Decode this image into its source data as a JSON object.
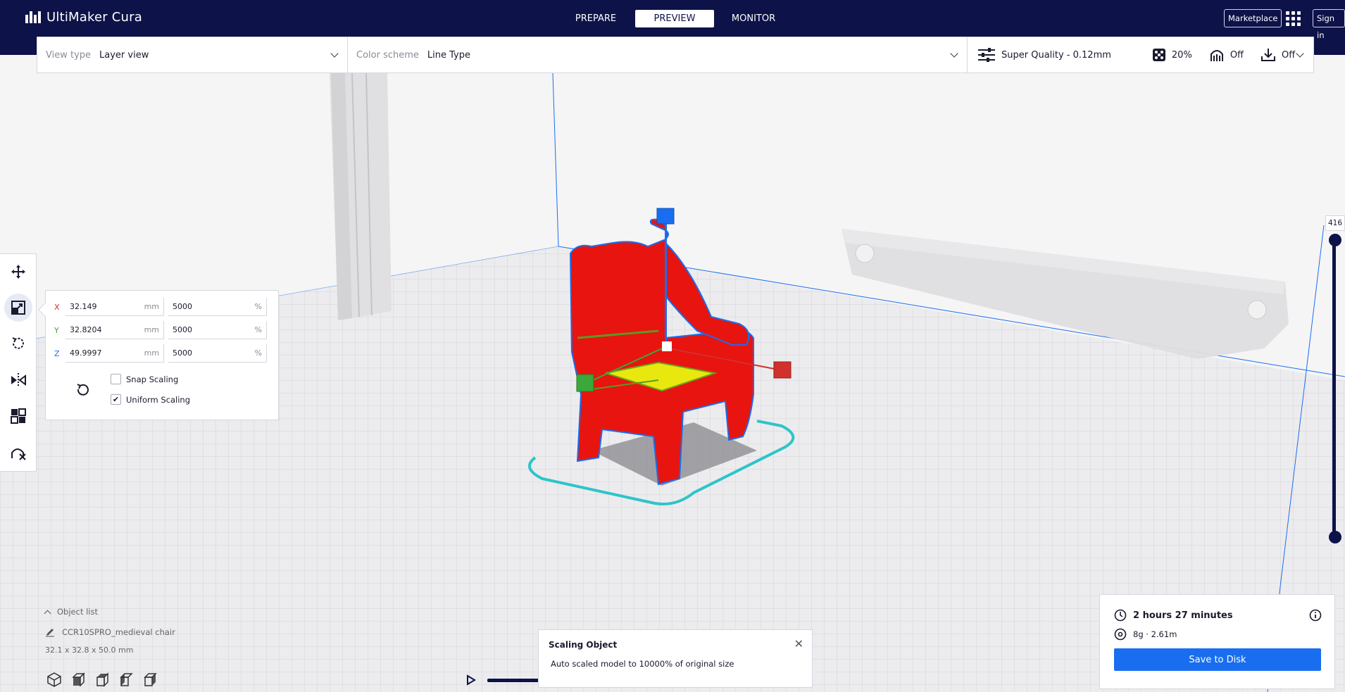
{
  "app": {
    "title": "UltiMaker Cura"
  },
  "stages": [
    {
      "label": "PREPARE",
      "active": false
    },
    {
      "label": "PREVIEW",
      "active": true
    },
    {
      "label": "MONITOR",
      "active": false
    }
  ],
  "header": {
    "marketplace_label": "Marketplace",
    "signin_label": "Sign in"
  },
  "toolbar": {
    "view_type_label": "View type",
    "view_type_value": "Layer view",
    "color_scheme_label": "Color scheme",
    "color_scheme_value": "Line Type",
    "quality": "Super Quality - 0.12mm",
    "infill": "20%",
    "support": "Off",
    "adhesion": "Off"
  },
  "scale_panel": {
    "rows": [
      {
        "axis": "X",
        "color": "#d0312d",
        "mm": "32.149",
        "percent": "5000"
      },
      {
        "axis": "Y",
        "color": "#3aa83a",
        "mm": "32.8204",
        "percent": "5000"
      },
      {
        "axis": "Z",
        "color": "#196ef0",
        "mm": "49.9997",
        "percent": "5000"
      }
    ],
    "mm_unit": "mm",
    "percent_unit": "%",
    "snap_scaling_label": "Snap Scaling",
    "snap_scaling_checked": false,
    "uniform_scaling_label": "Uniform Scaling",
    "uniform_scaling_checked": true,
    "uniform_check_glyph": "✔"
  },
  "object_list": {
    "header": "Object list",
    "object_name": "CCR10SPRO_medieval chair",
    "dimensions": "32.1 x 32.8 x 50.0 mm"
  },
  "notification": {
    "title": "Scaling Object",
    "body": "Auto scaled model to 10000% of original size",
    "close_glyph": "✕"
  },
  "print_info": {
    "time": "2 hours 27 minutes",
    "material": "8g · 2.61m",
    "save_label": "Save to Disk"
  },
  "layer_slider": {
    "current_layer": "416"
  },
  "colors": {
    "header_bg": "#0d1248",
    "accent": "#196ef0",
    "model_red": "#e8140f",
    "skirt_cyan": "#2ec4c9"
  }
}
